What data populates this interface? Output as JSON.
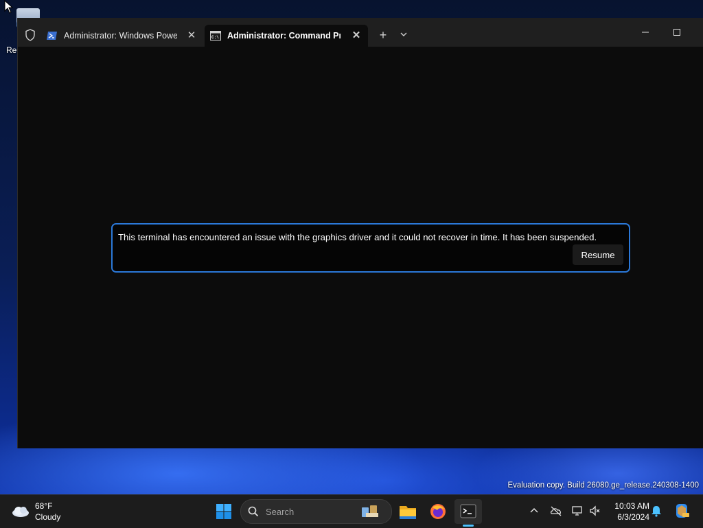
{
  "desktop": {
    "recycle_bin_label": "Rec",
    "watermark": "Evaluation copy. Build 26080.ge_release.240308-1400"
  },
  "window": {
    "tabs": [
      {
        "label": "Administrator: Windows PowerShell",
        "icon": "powershell-icon",
        "active": false
      },
      {
        "label": "Administrator: Command Prompt",
        "icon": "command-prompt-icon",
        "active": true
      }
    ],
    "infobar": {
      "message": "This terminal has encountered an issue with the graphics driver and it could not recover in time. It has been suspended.",
      "resume_label": "Resume"
    }
  },
  "taskbar": {
    "weather": {
      "temp": "68°F",
      "condition": "Cloudy"
    },
    "search_placeholder": "Search",
    "clock": {
      "time": "10:03 AM",
      "date": "6/3/2024"
    }
  },
  "colors": {
    "accent": "#2b78d8",
    "terminal_bg": "#0c0c0c",
    "titlebar_bg": "#1f1f1f",
    "taskbar_bg": "#1c1c1c"
  }
}
